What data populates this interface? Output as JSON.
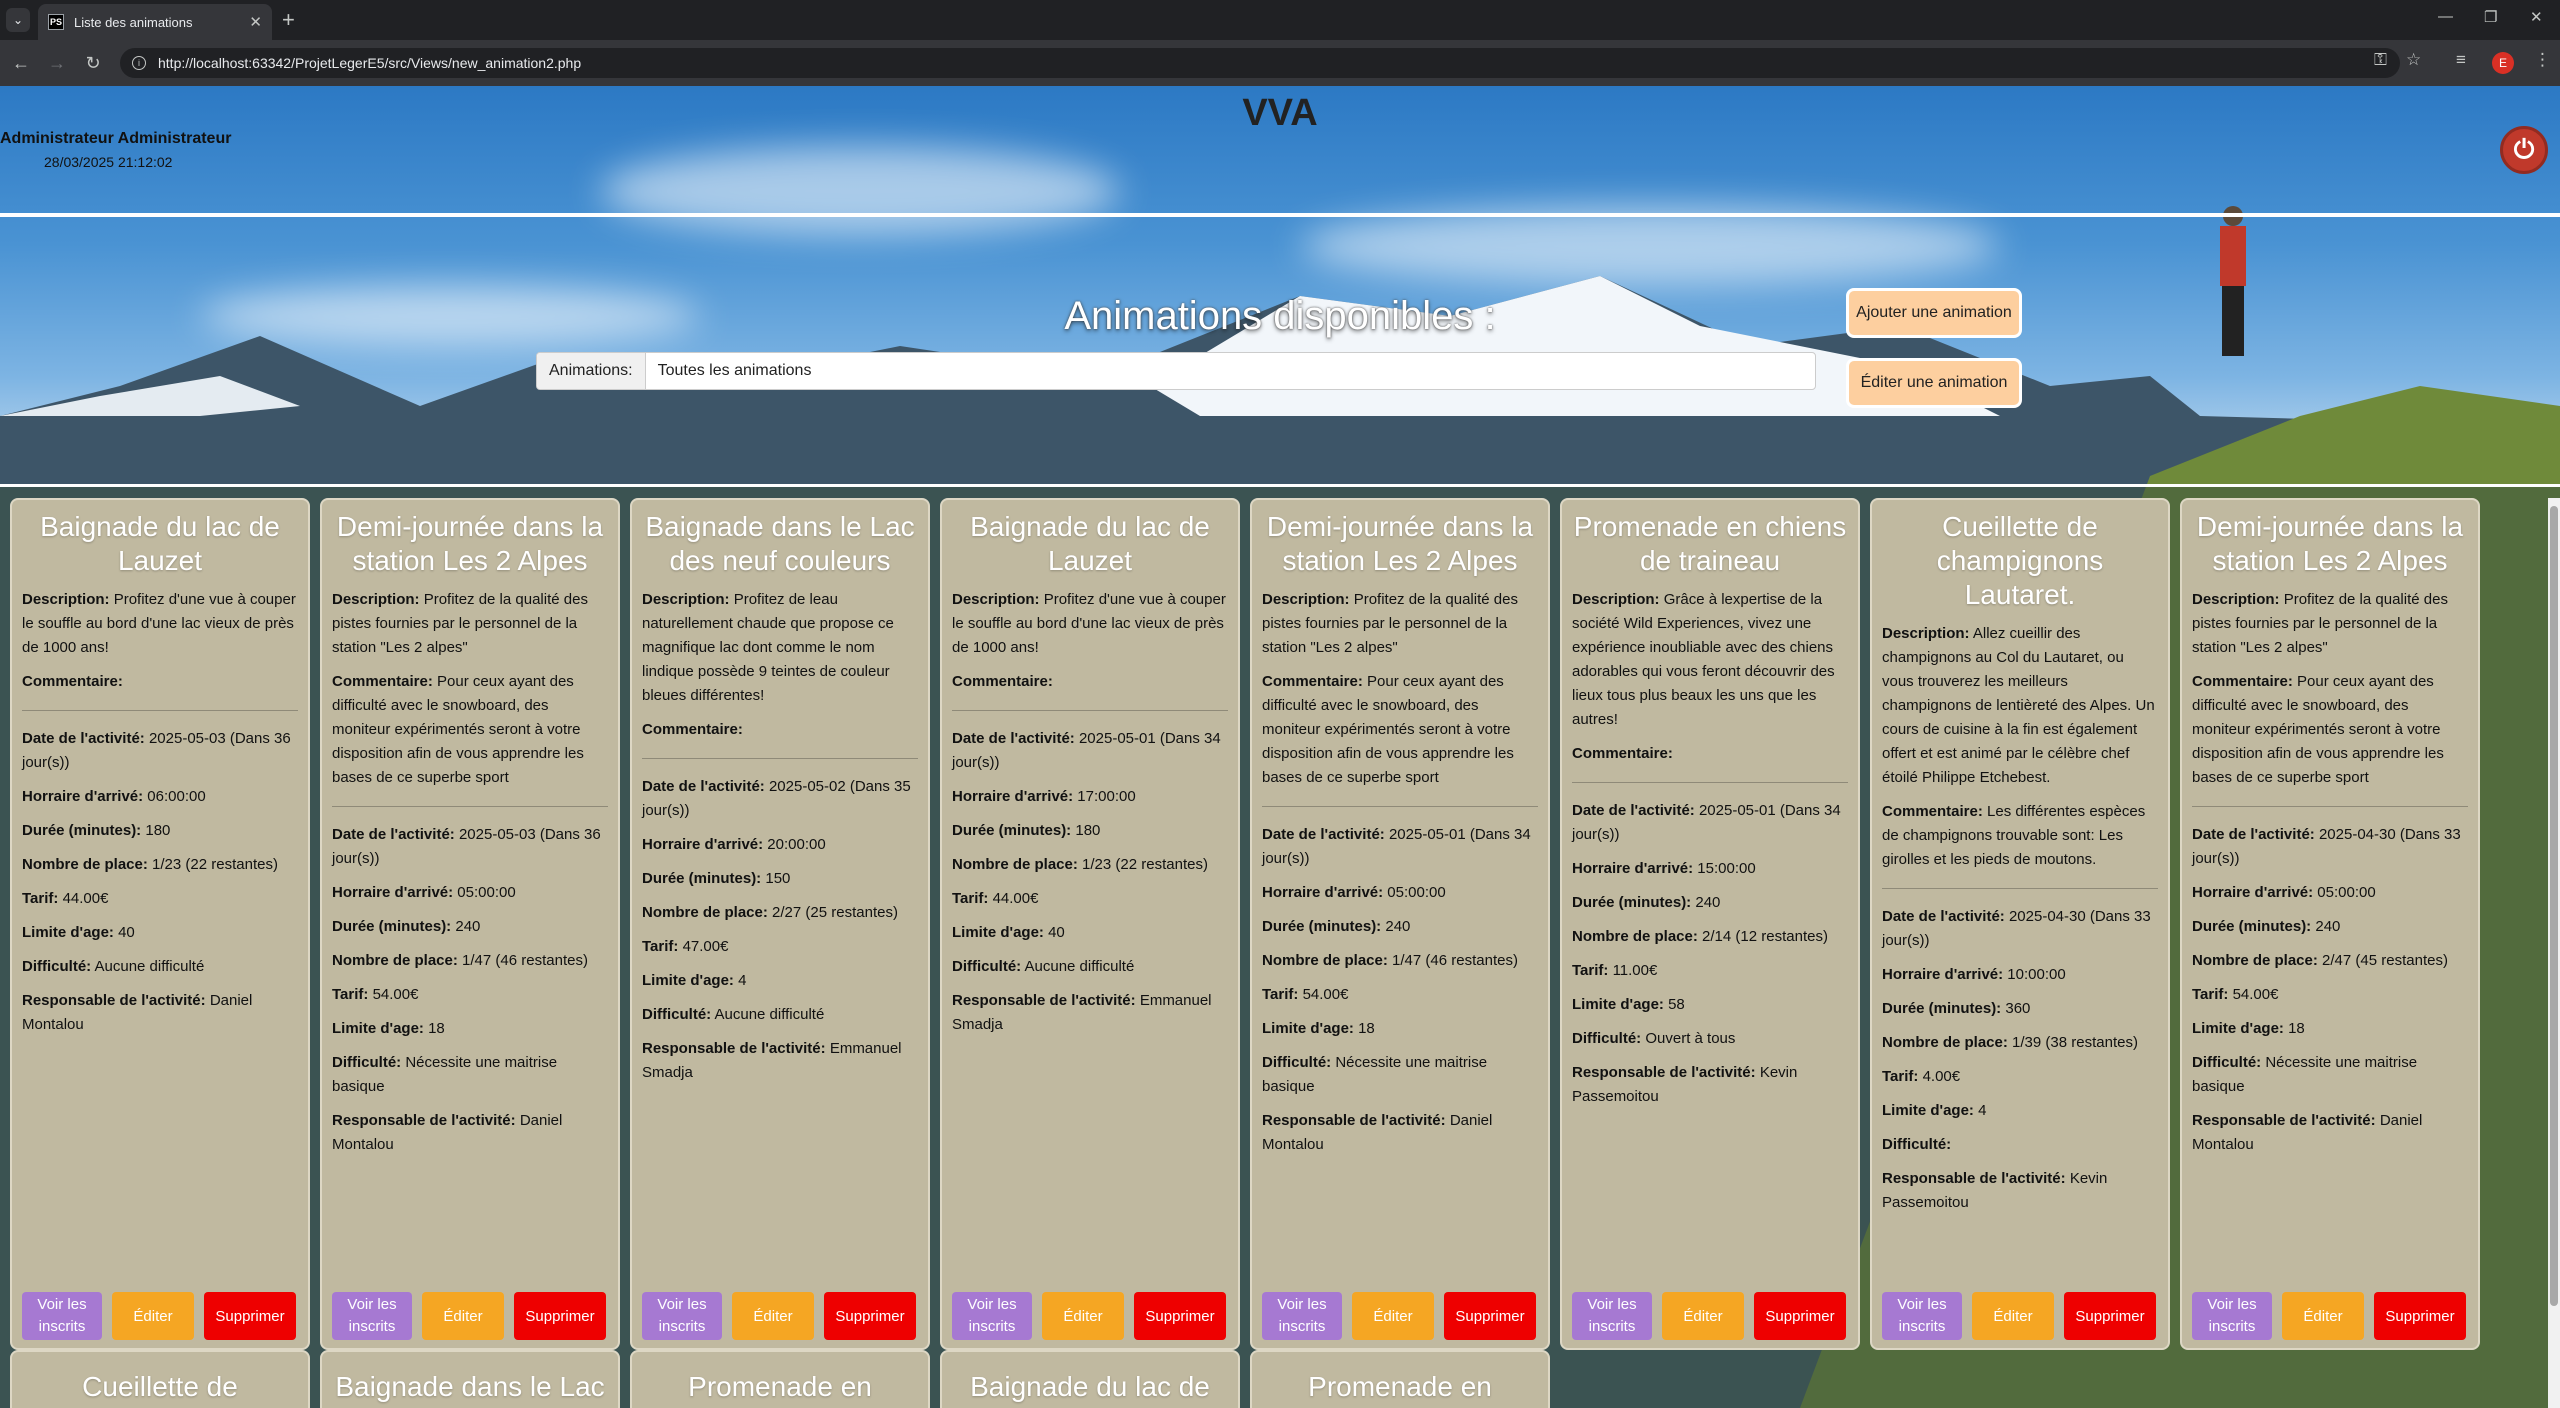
{
  "browser": {
    "tab_title": "Liste des animations",
    "favicon_text": "PS",
    "url": "http://localhost:63342/ProjetLegerE5/src/Views/new_animation2.php",
    "profile_initial": "E"
  },
  "header": {
    "admin_name": "Administrateur Administrateur",
    "datetime": "28/03/2025 21:12:02",
    "site_title": "VVA"
  },
  "hero": {
    "title": "Animations disponibles :",
    "filter_label": "Animations:",
    "filter_value": "Toutes les animations",
    "add_button": "Ajouter une animation",
    "edit_button": "Éditer une animation"
  },
  "labels": {
    "description": "Description:",
    "commentaire": "Commentaire:",
    "date": "Date de l'activité:",
    "horaire": "Horraire d'arrivé:",
    "duree": "Durée (minutes):",
    "places": "Nombre de place:",
    "tarif": "Tarif:",
    "age": "Limite d'age:",
    "difficulte": "Difficulté:",
    "responsable": "Responsable de l'activité:",
    "btn_voir": "Voir les inscrits",
    "btn_editer": "Éditer",
    "btn_supprimer": "Supprimer"
  },
  "cards": [
    {
      "title": "Baignade du lac de Lauzet",
      "description": "Profitez d'une vue à couper le souffle au bord d'une lac vieux de près de 1000 ans!",
      "commentaire": "",
      "date": "2025-05-03 (Dans 36 jour(s))",
      "horaire": "06:00:00",
      "duree": "180",
      "places": "1/23 (22 restantes)",
      "tarif": "44.00€",
      "age": "40",
      "difficulte": "Aucune difficulté",
      "responsable": "Daniel Montalou"
    },
    {
      "title": "Demi-journée dans la station Les 2 Alpes",
      "description": "Profitez de la qualité des pistes fournies par le personnel de la station \"Les 2 alpes\"",
      "commentaire": "Pour ceux ayant des difficulté avec le snowboard, des moniteur expérimentés seront à votre disposition afin de vous apprendre les bases de ce superbe sport",
      "date": "2025-05-03 (Dans 36 jour(s))",
      "horaire": "05:00:00",
      "duree": "240",
      "places": "1/47 (46 restantes)",
      "tarif": "54.00€",
      "age": "18",
      "difficulte": "Nécessite une maitrise basique",
      "responsable": "Daniel Montalou"
    },
    {
      "title": "Baignade dans le Lac des neuf couleurs",
      "description": "Profitez de leau naturellement chaude que propose ce magnifique lac dont comme le nom lindique possède 9 teintes de couleur bleues différentes!",
      "commentaire": "",
      "date": "2025-05-02 (Dans 35 jour(s))",
      "horaire": "20:00:00",
      "duree": "150",
      "places": "2/27 (25 restantes)",
      "tarif": "47.00€",
      "age": "4",
      "difficulte": "Aucune difficulté",
      "responsable": "Emmanuel Smadja"
    },
    {
      "title": "Baignade du lac de Lauzet",
      "description": "Profitez d'une vue à couper le souffle au bord d'une lac vieux de près de 1000 ans!",
      "commentaire": "",
      "date": "2025-05-01 (Dans 34 jour(s))",
      "horaire": "17:00:00",
      "duree": "180",
      "places": "1/23 (22 restantes)",
      "tarif": "44.00€",
      "age": "40",
      "difficulte": "Aucune difficulté",
      "responsable": "Emmanuel Smadja"
    },
    {
      "title": "Demi-journée dans la station Les 2 Alpes",
      "description": "Profitez de la qualité des pistes fournies par le personnel de la station \"Les 2 alpes\"",
      "commentaire": "Pour ceux ayant des difficulté avec le snowboard, des moniteur expérimentés seront à votre disposition afin de vous apprendre les bases de ce superbe sport",
      "date": "2025-05-01 (Dans 34 jour(s))",
      "horaire": "05:00:00",
      "duree": "240",
      "places": "1/47 (46 restantes)",
      "tarif": "54.00€",
      "age": "18",
      "difficulte": "Nécessite une maitrise basique",
      "responsable": "Daniel Montalou"
    },
    {
      "title": "Promenade en chiens de traineau",
      "description": "Grâce à lexpertise de la société Wild Experiences, vivez une expérience inoubliable avec des chiens adorables qui vous feront découvrir des lieux tous plus beaux les uns que les autres!",
      "commentaire": "",
      "date": "2025-05-01 (Dans 34 jour(s))",
      "horaire": "15:00:00",
      "duree": "240",
      "places": "2/14 (12 restantes)",
      "tarif": "11.00€",
      "age": "58",
      "difficulte": "Ouvert à tous",
      "responsable": "Kevin Passemoitou"
    },
    {
      "title": "Cueillette de champignons Lautaret.",
      "description": "Allez cueillir des champignons au Col du Lautaret, ou vous trouverez les meilleurs champignons de lentièreté des Alpes. Un cours de cuisine à la fin est également offert et est animé par le célèbre chef étoilé Philippe Etchebest.",
      "commentaire": "Les différentes espèces de champignons trouvable sont: Les girolles et les pieds de moutons.",
      "date": "2025-04-30 (Dans 33 jour(s))",
      "horaire": "10:00:00",
      "duree": "360",
      "places": "1/39 (38 restantes)",
      "tarif": "4.00€",
      "age": "4",
      "difficulte": "",
      "responsable": "Kevin Passemoitou"
    },
    {
      "title": "Demi-journée dans la station Les 2 Alpes",
      "description": "Profitez de la qualité des pistes fournies par le personnel de la station \"Les 2 alpes\"",
      "commentaire": "Pour ceux ayant des difficulté avec le snowboard, des moniteur expérimentés seront à votre disposition afin de vous apprendre les bases de ce superbe sport",
      "date": "2025-04-30 (Dans 33 jour(s))",
      "horaire": "05:00:00",
      "duree": "240",
      "places": "2/47 (45 restantes)",
      "tarif": "54.00€",
      "age": "18",
      "difficulte": "Nécessite une maitrise basique",
      "responsable": "Daniel Montalou"
    }
  ],
  "next_row_titles": [
    "Cueillette de",
    "Baignade dans le Lac",
    "Promenade en",
    "Baignade du lac de",
    "Promenade en"
  ]
}
